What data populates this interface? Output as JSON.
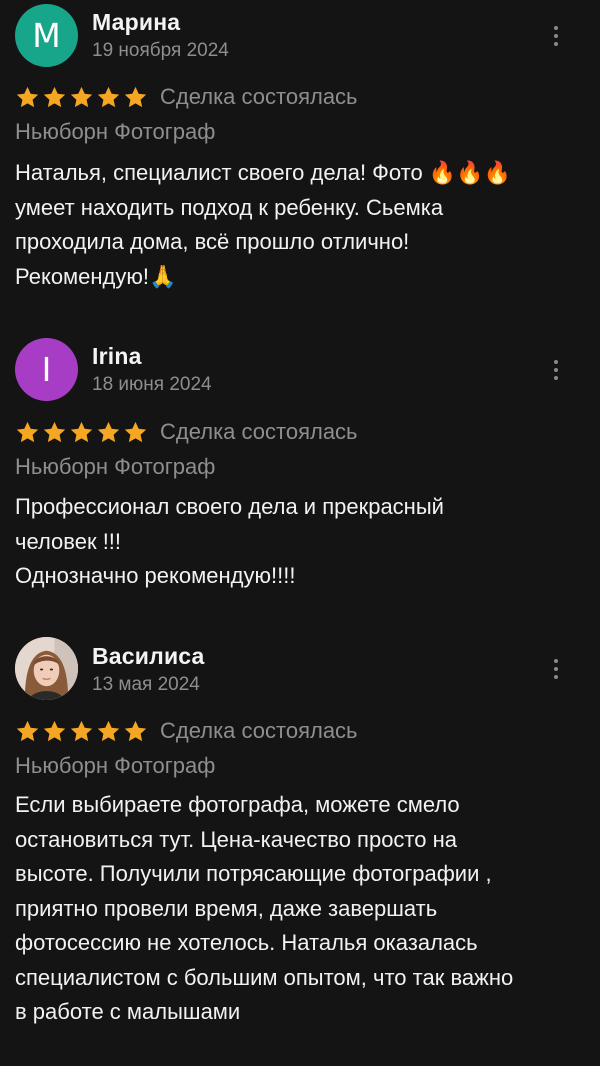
{
  "colors": {
    "background": "#141414",
    "star": "#f5a623",
    "muted_text": "#8e8e8e",
    "avatar_marina": "#17a689",
    "avatar_irina": "#a63dc4"
  },
  "reviews": [
    {
      "avatar_letter": "М",
      "author": "Марина",
      "date": "19 ноября 2024",
      "rating": 5,
      "deal_status": "Сделка состоялась",
      "service": "Ньюборн Фотограф",
      "text": "Наталья, специалист своего дела! Фото 🔥🔥🔥\nумеет находить подход к ребенку. Сьемка\nпроходила дома, всё прошло отлично!\nРекомендую!🙏"
    },
    {
      "avatar_letter": "I",
      "author": "Irina",
      "date": "18 июня 2024",
      "rating": 5,
      "deal_status": "Сделка состоялась",
      "service": "Ньюборн Фотограф",
      "text": "Профессионал своего дела и прекрасный\nчеловек !!!\nОднозначно рекомендую!!!!"
    },
    {
      "avatar_letter": "",
      "author": "Василиса",
      "date": "13 мая 2024",
      "rating": 5,
      "deal_status": "Сделка состоялась",
      "service": "Ньюборн Фотограф",
      "text": "Если выбираете фотографа, можете смело\nостановиться тут. Цена-качество просто на\nвысоте. Получили потрясающие фотографии ,\nприятно провели время, даже завершать\nфотосессию не хотелось. Наталья оказалась\nспециалистом с большим опытом, что так важно\nв работе с малышами"
    }
  ]
}
